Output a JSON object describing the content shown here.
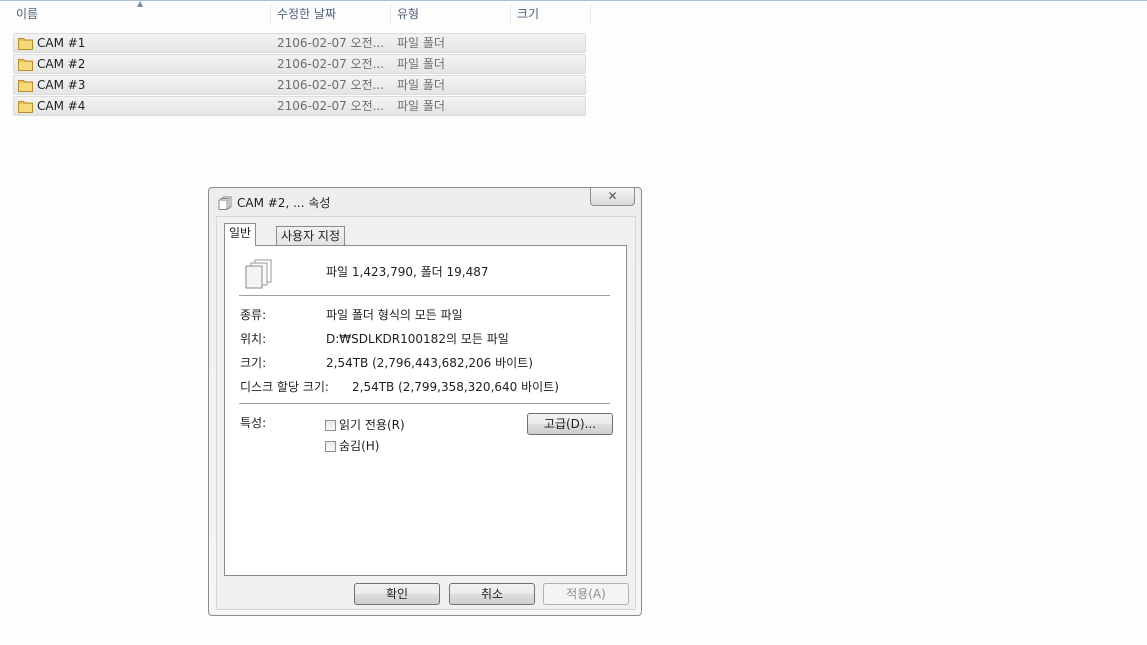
{
  "explorer": {
    "columns": [
      {
        "label": "이름"
      },
      {
        "label": "수정한 날짜"
      },
      {
        "label": "유형"
      },
      {
        "label": "크기"
      }
    ],
    "rows": [
      {
        "name": "CAM #1",
        "date": "2106-02-07 오전...",
        "type": "파일 폴더"
      },
      {
        "name": "CAM #2",
        "date": "2106-02-07 오전...",
        "type": "파일 폴더"
      },
      {
        "name": "CAM #3",
        "date": "2106-02-07 오전...",
        "type": "파일 폴더"
      },
      {
        "name": "CAM #4",
        "date": "2106-02-07 오전...",
        "type": "파일 폴더"
      }
    ]
  },
  "dialog": {
    "title": "CAM #2, ... 속성",
    "close_glyph": "✕",
    "tabs": [
      {
        "label": "일반",
        "active": true
      },
      {
        "label": "사용자 지정",
        "active": false
      }
    ],
    "summary": "파일 1,423,790, 폴더 19,487",
    "properties": {
      "kind_label": "종류:",
      "kind_value": "파일 폴더 형식의 모든 파일",
      "location_label": "위치:",
      "location_value": "D:₩SDLKDR100182의 모든 파일",
      "size_label": "크기:",
      "size_value": "2,54TB (2,796,443,682,206 바이트)",
      "disk_label": "디스크 할당 크기:",
      "disk_value": "2,54TB (2,799,358,320,640 바이트)"
    },
    "attributes": {
      "label": "특성:",
      "readonly_label": "읽기 전용(R)",
      "readonly_checked": false,
      "hidden_label": "숨김(H)",
      "hidden_checked": false,
      "advanced_label": "고급(D)..."
    },
    "buttons": {
      "ok": "확인",
      "cancel": "취소",
      "apply": "적용(A)"
    }
  },
  "colors": {
    "folder_yellow": "#e8c25a",
    "header_text": "#4c607a"
  }
}
